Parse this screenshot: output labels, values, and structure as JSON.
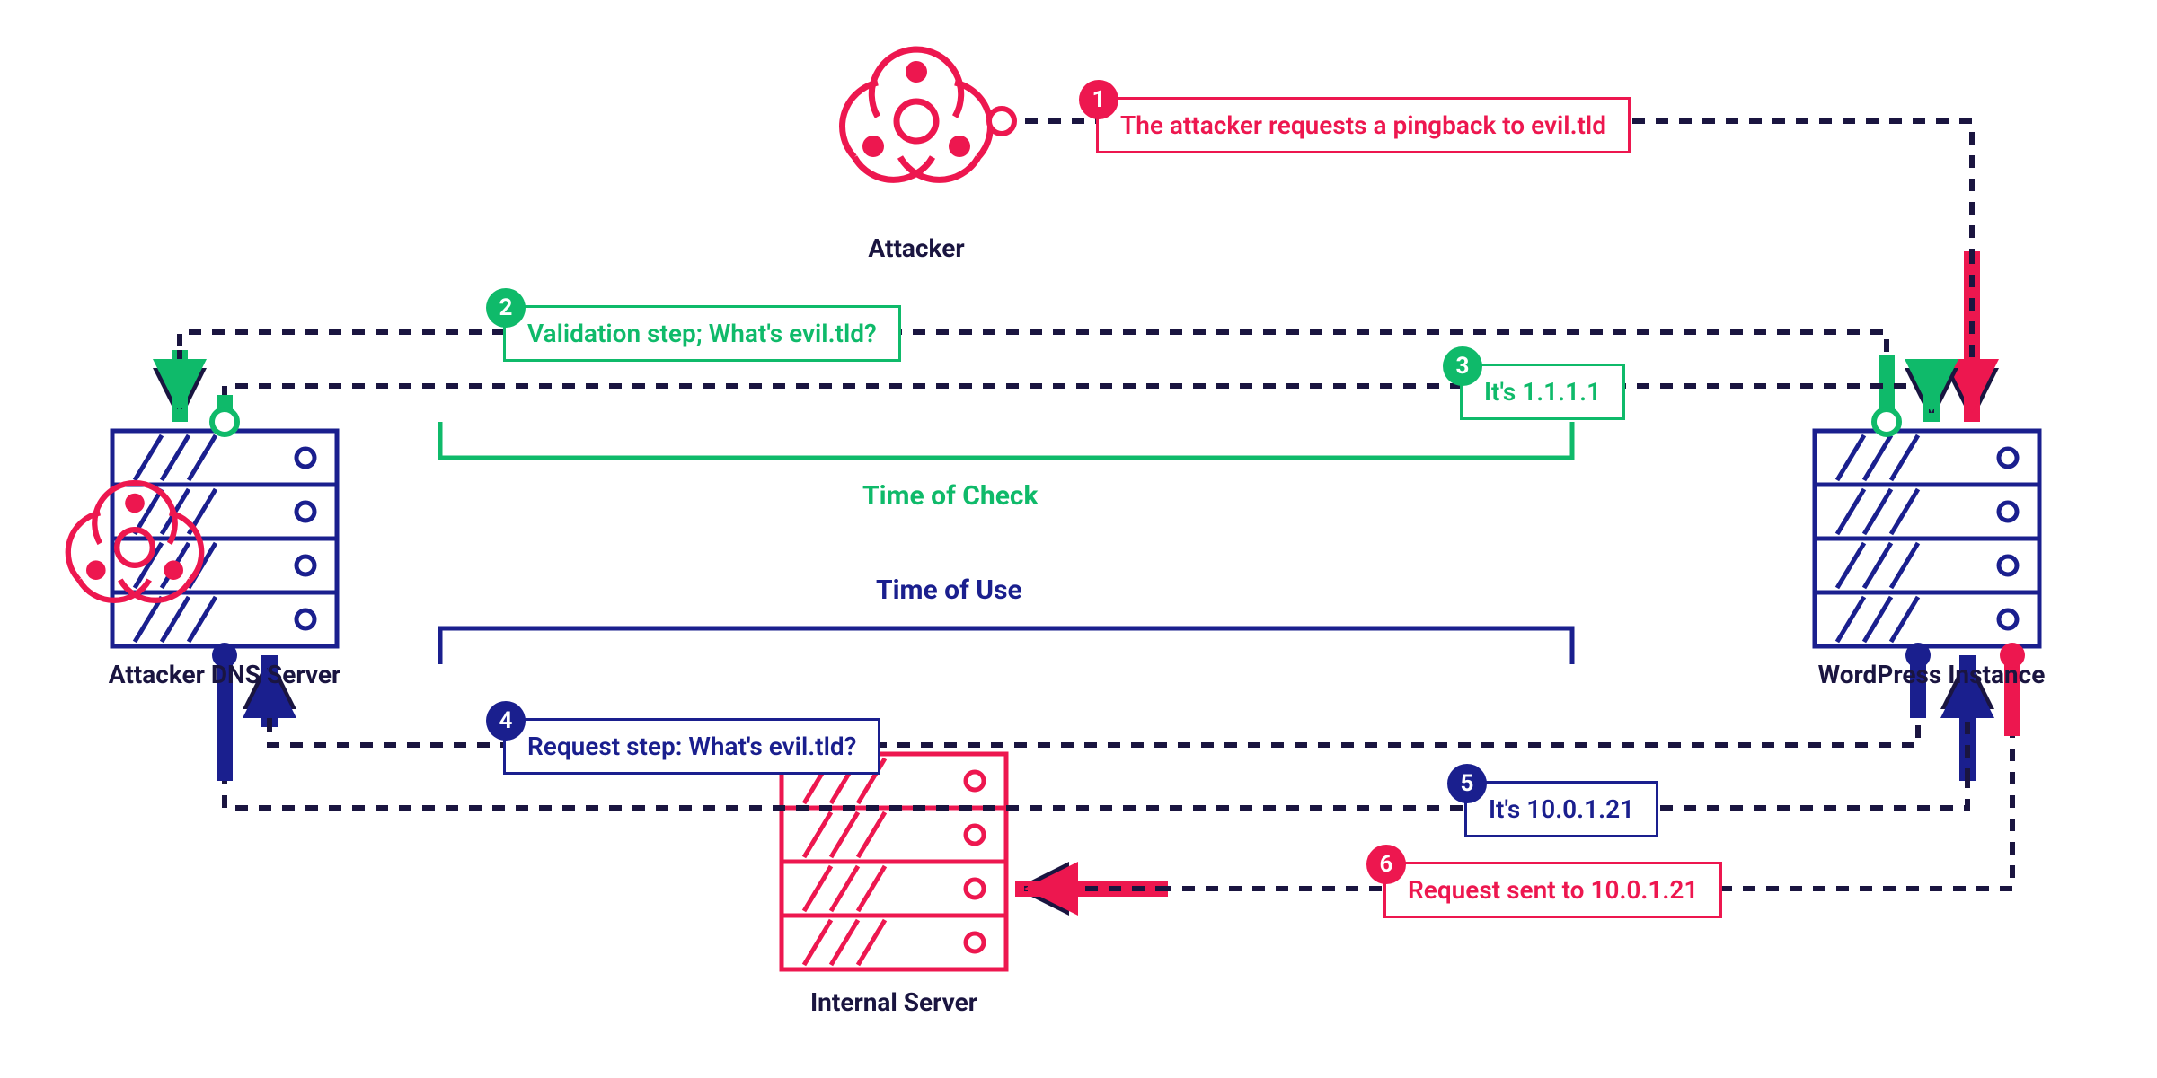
{
  "nodes": {
    "attacker": "Attacker",
    "dns": "Attacker DNS Server",
    "wordpress": "WordPress Instance",
    "internal": "Internal Server"
  },
  "steps": {
    "s1": {
      "num": "1",
      "text": "The attacker requests a pingback to evil.tld"
    },
    "s2": {
      "num": "2",
      "text": "Validation step; What's evil.tld?"
    },
    "s3": {
      "num": "3",
      "text": "It's 1.1.1.1"
    },
    "s4": {
      "num": "4",
      "text": "Request step: What's evil.tld?"
    },
    "s5": {
      "num": "5",
      "text": "It's 10.0.1.21"
    },
    "s6": {
      "num": "6",
      "text": "Request sent to 10.0.1.21"
    }
  },
  "phases": {
    "check": "Time of Check",
    "use": "Time of Use"
  },
  "colors": {
    "red": "#ed174f",
    "green": "#0fba6a",
    "navy": "#1a1f8e",
    "dark": "#1a1540",
    "pale": "#fde4dd"
  }
}
